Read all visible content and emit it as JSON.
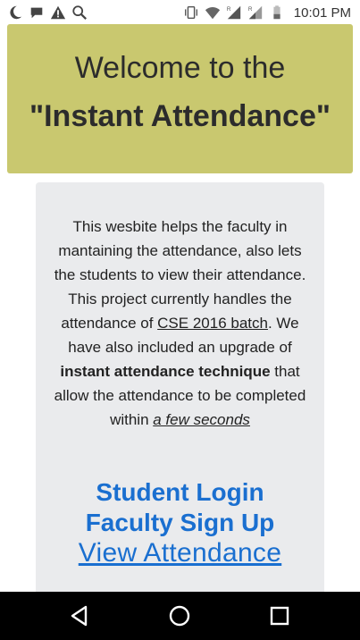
{
  "status_bar": {
    "time": "10:01 PM",
    "left_icons": [
      "moon-icon",
      "chat-icon",
      "warning-icon",
      "search-icon"
    ],
    "right_icons": [
      "vibrate-icon",
      "wifi-icon",
      "signal-r-icon",
      "signal-r-icon-2",
      "battery-icon"
    ]
  },
  "banner": {
    "line1": "Welcome to the",
    "line2": "\"Instant Attendance\"",
    "color": "#c9c86f"
  },
  "description": {
    "t1": "This wesbite helps the faculty in mantaining the attendance, also lets the students to view their attendance. This project currently handles the attendance of ",
    "u1": "CSE 2016 batch",
    "t2": ". We have also included an upgrade of ",
    "b1": "instant attendance technique",
    "t3": " that allow the attendance to be completed within ",
    "i1": "a few seconds"
  },
  "links": {
    "student_login": "Student Login",
    "faculty_signup": "Faculty Sign Up",
    "view_attendance": "View Attendance",
    "color": "#1a6fd0"
  },
  "nav": {
    "icons": [
      "back-icon",
      "home-icon",
      "recents-icon"
    ]
  }
}
